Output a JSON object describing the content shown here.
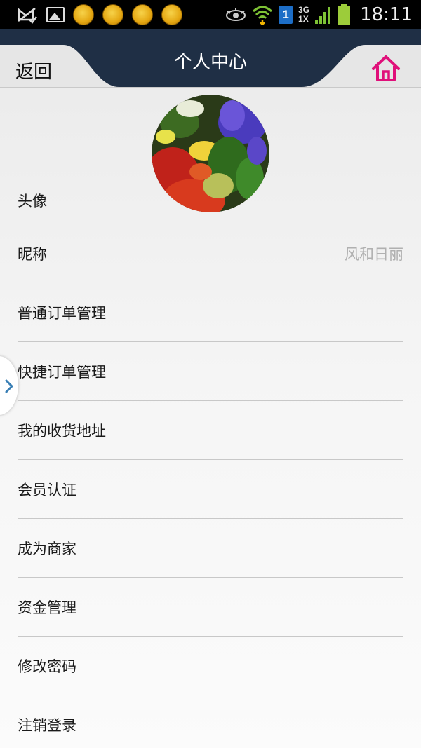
{
  "status_bar": {
    "time": "18:11",
    "sim_slot": "1",
    "network_top": "3G",
    "network_bottom": "1X",
    "icons": [
      "message-icon",
      "gallery-icon",
      "app-coin-icon",
      "app-coin-icon",
      "app-coin-icon",
      "app-coin-icon",
      "eye-icon",
      "wifi-icon",
      "sim-icon",
      "signal-icon",
      "battery-icon"
    ]
  },
  "header": {
    "back_label": "返回",
    "title": "个人中心",
    "home_icon": "home-icon",
    "accent_color": "#e0107a",
    "bar_color": "#1f2f45"
  },
  "profile": {
    "rows": [
      {
        "label": "头像",
        "value": ""
      },
      {
        "label": "昵称",
        "value": "风和日丽"
      },
      {
        "label": "普通订单管理",
        "value": ""
      },
      {
        "label": "快捷订单管理",
        "value": ""
      },
      {
        "label": "我的收货地址",
        "value": ""
      },
      {
        "label": "会员认证",
        "value": ""
      },
      {
        "label": "成为商家",
        "value": ""
      },
      {
        "label": "资金管理",
        "value": ""
      },
      {
        "label": "修改密码",
        "value": ""
      },
      {
        "label": "注销登录",
        "value": ""
      }
    ]
  }
}
